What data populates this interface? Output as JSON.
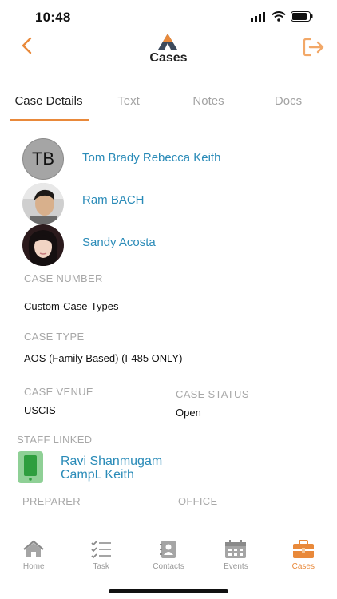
{
  "status_bar": {
    "time": "10:48"
  },
  "header": {
    "title": "Cases"
  },
  "tabs": [
    {
      "label": "Case Details",
      "active": true
    },
    {
      "label": "Text",
      "active": false
    },
    {
      "label": "Notes",
      "active": false
    },
    {
      "label": "Docs",
      "active": false
    }
  ],
  "contacts": [
    {
      "name": "Tom Brady Rebecca Keith",
      "initials": "TB"
    },
    {
      "name": "Ram BACH"
    },
    {
      "name": "Sandy Acosta"
    }
  ],
  "case": {
    "number_label": "CASE NUMBER",
    "number_value": "Custom-Case-Types",
    "type_label": "CASE TYPE",
    "type_value": "AOS (Family Based) (I-485 ONLY)",
    "venue_label": "CASE VENUE",
    "venue_value": "USCIS",
    "status_label": "CASE STATUS",
    "status_value": "Open"
  },
  "staff": {
    "label": "STAFF LINKED",
    "name_line1": "Ravi Shanmugam",
    "name_line2": "CampL Keith",
    "preparer_label": "PREPARER",
    "office_label": "OFFICE"
  },
  "bottom_nav": [
    {
      "label": "Home",
      "icon": "home-icon"
    },
    {
      "label": "Task",
      "icon": "task-list-icon"
    },
    {
      "label": "Contacts",
      "icon": "contacts-icon"
    },
    {
      "label": "Events",
      "icon": "calendar-icon"
    },
    {
      "label": "Cases",
      "icon": "briefcase-icon",
      "active": true
    }
  ],
  "colors": {
    "accent": "#e9893a",
    "link": "#2a8bb8",
    "label": "#a8a8a8"
  }
}
